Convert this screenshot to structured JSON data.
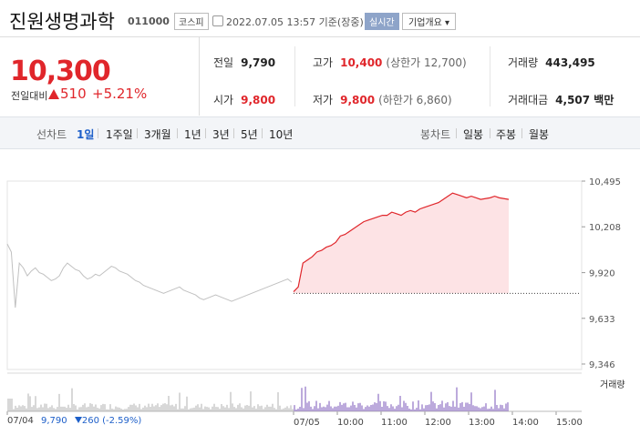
{
  "header": {
    "name": "진원생명과학",
    "code": "011000",
    "market": "코스피",
    "time": "2022.07.05 13:57 기준(장중)",
    "realtime": "실시간",
    "corp_info": "기업개요 ▾"
  },
  "quote": {
    "price": "10,300",
    "change_label": "전일대비",
    "change_value": "510",
    "change_pct": "+5.21%"
  },
  "stats": {
    "prev_label": "전일",
    "prev_value": "9,790",
    "high_label": "고가",
    "high_value": "10,400",
    "high_sub": "(상한가 12,700)",
    "volume_label": "거래량",
    "volume_value": "443,495",
    "open_label": "시가",
    "open_value": "9,800",
    "low_label": "저가",
    "low_value": "9,800",
    "low_sub": "(하한가 6,860)",
    "amount_label": "거래대금",
    "amount_value": "4,507 백만"
  },
  "tabs": {
    "line_label": "선차트",
    "line_items": [
      "1일",
      "1주일",
      "3개월",
      "1년",
      "3년",
      "5년",
      "10년"
    ],
    "candle_label": "봉차트",
    "candle_items": [
      "일봉",
      "주봉",
      "월봉"
    ]
  },
  "chart_data": {
    "type": "line",
    "y_ticks": [
      "10,495",
      "10,208",
      "9,920",
      "9,633",
      "9,346"
    ],
    "ylim": [
      9346,
      10495
    ],
    "x_ticks": [
      "07/04",
      "07/05",
      "10:00",
      "11:00",
      "12:00",
      "13:00",
      "14:00",
      "15:00"
    ],
    "prev_close": 9790,
    "prev_day_summary": {
      "date": "07/04",
      "price": "9,790",
      "change": "260",
      "pct": "(-2.59%)"
    },
    "volume_label": "거래량",
    "series": [
      {
        "values_prev": [
          10100,
          10050,
          9700,
          9980,
          9950,
          9900,
          9930,
          9950,
          9920,
          9910,
          9890,
          9870,
          9880,
          9900,
          9950,
          9980,
          9960,
          9940,
          9930,
          9900,
          9880,
          9890,
          9910,
          9900,
          9920,
          9940,
          9960,
          9950,
          9930,
          9920,
          9910,
          9890,
          9870,
          9860,
          9840,
          9830,
          9820,
          9810,
          9800,
          9790,
          9800,
          9810,
          9820,
          9830,
          9810,
          9800,
          9790,
          9780,
          9760,
          9750,
          9760,
          9770,
          9780,
          9770,
          9760,
          9750,
          9740,
          9750,
          9760,
          9770,
          9780,
          9790,
          9800,
          9810,
          9820,
          9830,
          9840,
          9850,
          9860,
          9870,
          9880,
          9860
        ]
      },
      {
        "values_today": [
          9800,
          9830,
          9980,
          10000,
          10020,
          10050,
          10060,
          10080,
          10090,
          10110,
          10150,
          10160,
          10180,
          10200,
          10220,
          10240,
          10250,
          10260,
          10270,
          10280,
          10280,
          10300,
          10290,
          10280,
          10300,
          10310,
          10300,
          10320,
          10330,
          10340,
          10350,
          10360,
          10380,
          10400,
          10420,
          10410,
          10400,
          10390,
          10400,
          10390,
          10380,
          10385,
          10390,
          10400,
          10390,
          10385,
          10380
        ]
      }
    ]
  }
}
